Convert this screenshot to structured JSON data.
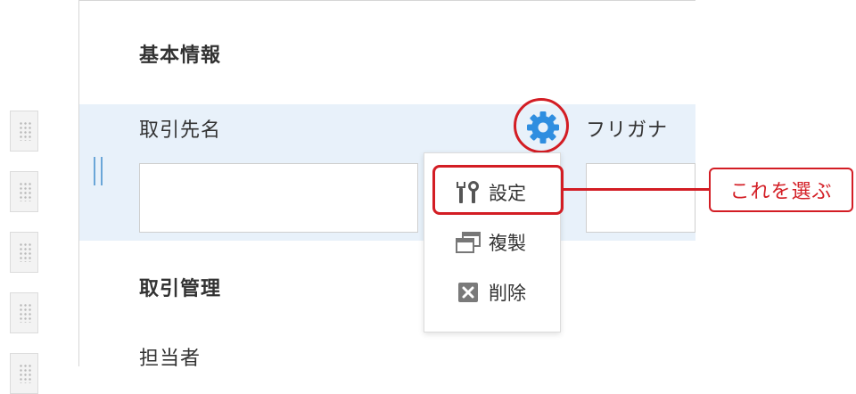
{
  "sections": {
    "basic_info": "基本情報",
    "transaction_management": "取引管理"
  },
  "fields": {
    "client_name": "取引先名",
    "furigana": "フリガナ",
    "person_in_charge": "担当者"
  },
  "context_menu": {
    "items": [
      {
        "label": "設定",
        "icon": "tools-icon"
      },
      {
        "label": "複製",
        "icon": "duplicate-icon"
      },
      {
        "label": "削除",
        "icon": "delete-icon"
      }
    ]
  },
  "annotation": {
    "callout_text": "これを選ぶ",
    "accent_color": "#d31d24"
  },
  "colors": {
    "gear": "#2f8ee0",
    "selected_row": "#e8f1fa"
  }
}
